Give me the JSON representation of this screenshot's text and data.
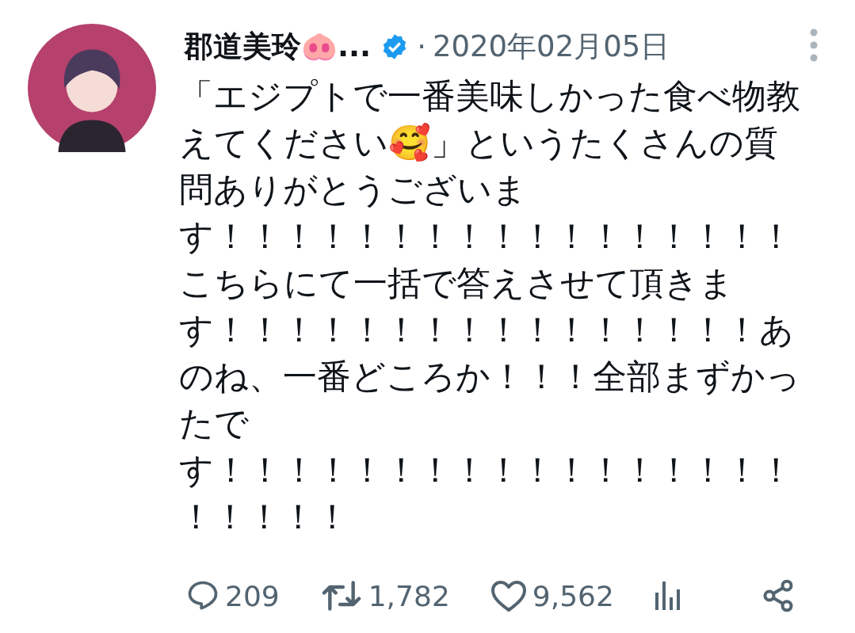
{
  "tweet": {
    "author": "郡道美玲🐽...",
    "separator": "·",
    "date": "2020年02月05日",
    "text_lines": [
      "「エジプトで一番美味しかった食べ物教",
      "えてください🥰」というたくさんの質",
      "問ありがとうございま",
      "す！！！！！！！！！！！！！！！！！",
      "こちらにて一括で答えさせて頂きま",
      "す！！！！！！！！！！！！！！！！あ",
      "のね、一番どころか！！！全部まずかっ",
      "たで",
      "す！！！！！！！！！！！！！！！！！",
      "！！！！！"
    ],
    "actions": [
      {
        "kind": "reply",
        "count": "209"
      },
      {
        "kind": "repost",
        "count": "1,782"
      },
      {
        "kind": "like",
        "count": "9,562"
      },
      {
        "kind": "views"
      },
      {
        "kind": "share"
      }
    ]
  }
}
